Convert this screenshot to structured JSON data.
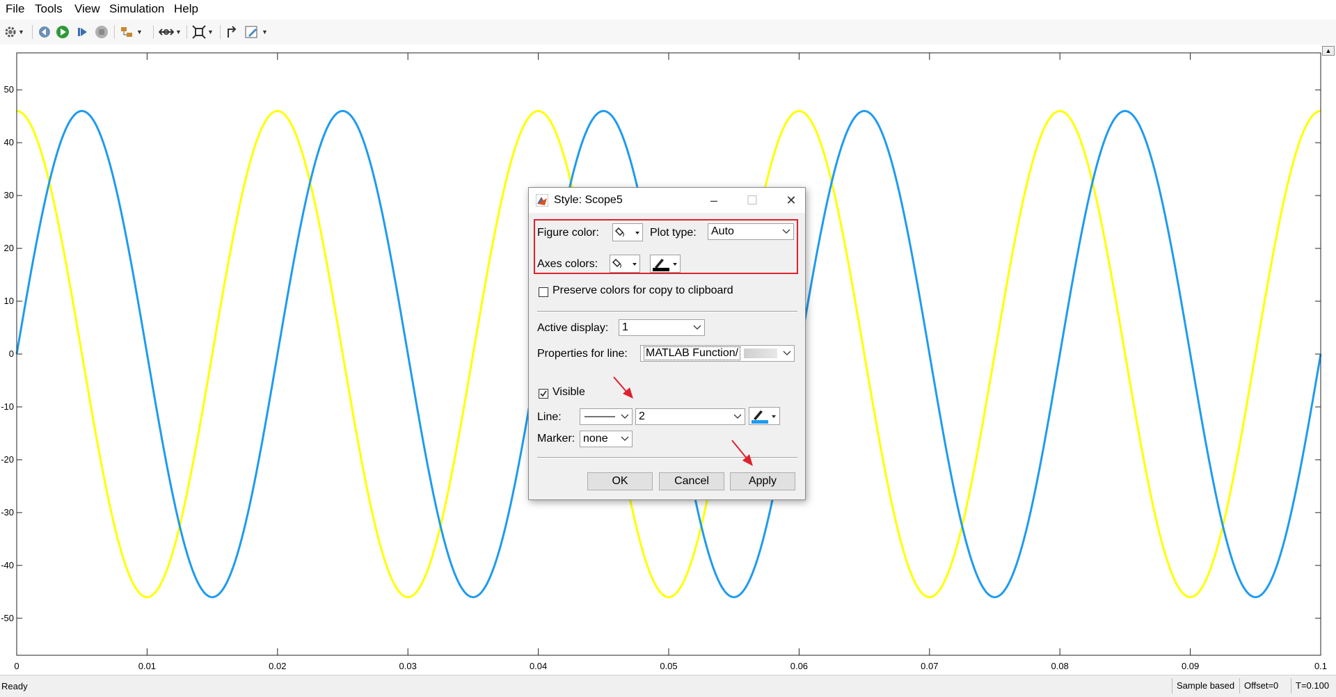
{
  "menu": [
    "File",
    "Tools",
    "View",
    "Simulation",
    "Help"
  ],
  "toolbar": {
    "icons": [
      "settings-gear-icon",
      "step-back-icon",
      "run-icon",
      "step-forward-icon",
      "stop-icon",
      "signal-select-icon",
      "zoom-icon",
      "autoscale-icon",
      "highlight-block-icon",
      "style-pencil-icon"
    ]
  },
  "plot": {
    "chart_data": {
      "type": "line",
      "xlim": [
        0,
        0.1
      ],
      "ylim": [
        -57,
        57
      ],
      "x_ticks": [
        "0",
        "0.01",
        "0.02",
        "0.03",
        "0.04",
        "0.05",
        "0.06",
        "0.07",
        "0.08",
        "0.09",
        "0.1"
      ],
      "y_ticks": [
        "50",
        "40",
        "30",
        "20",
        "10",
        "0",
        "-10",
        "-20",
        "-30",
        "-40",
        "-50"
      ],
      "grid": false,
      "series": [
        {
          "color": "#ffff00",
          "function": "46 * cos(2*pi*50*t)",
          "amplitude": 46,
          "frequency_hz": 50,
          "phase_deg": 90,
          "samples": {
            "x": [
              0,
              0.005,
              0.01,
              0.015,
              0.02
            ],
            "y": [
              46,
              0,
              -46,
              0,
              46
            ]
          }
        },
        {
          "color": "#1e9bef",
          "function": "46 * sin(2*pi*50*t)",
          "amplitude": 46,
          "frequency_hz": 50,
          "phase_deg": 0,
          "samples": {
            "x": [
              0,
              0.005,
              0.01,
              0.015,
              0.02
            ],
            "y": [
              0,
              46,
              0,
              -46,
              0
            ]
          }
        }
      ],
      "colors": {
        "line1": "#ffff00",
        "line2": "#1e9bef"
      }
    }
  },
  "status": {
    "ready": "Ready",
    "sample_mode": "Sample based",
    "offset": "Offset=0",
    "time": "T=0.100"
  },
  "dialog": {
    "title": "Style: Scope5",
    "figure_color_label": "Figure color:",
    "plot_type_label": "Plot type:",
    "plot_type_value": "Auto",
    "axes_colors_label": "Axes colors:",
    "preserve_label": "Preserve colors for copy to clipboard",
    "preserve_checked": false,
    "active_display_label": "Active display:",
    "active_display_value": "1",
    "properties_label": "Properties for line:",
    "properties_value": "MATLAB Function/",
    "visible_label": "Visible",
    "visible_checked": true,
    "line_label": "Line:",
    "line_width_value": "2",
    "marker_label": "Marker:",
    "marker_value": "none",
    "ok_label": "OK",
    "cancel_label": "Cancel",
    "apply_label": "Apply",
    "line_color": "#1e9bef",
    "highlight_color": "#e0202e"
  }
}
